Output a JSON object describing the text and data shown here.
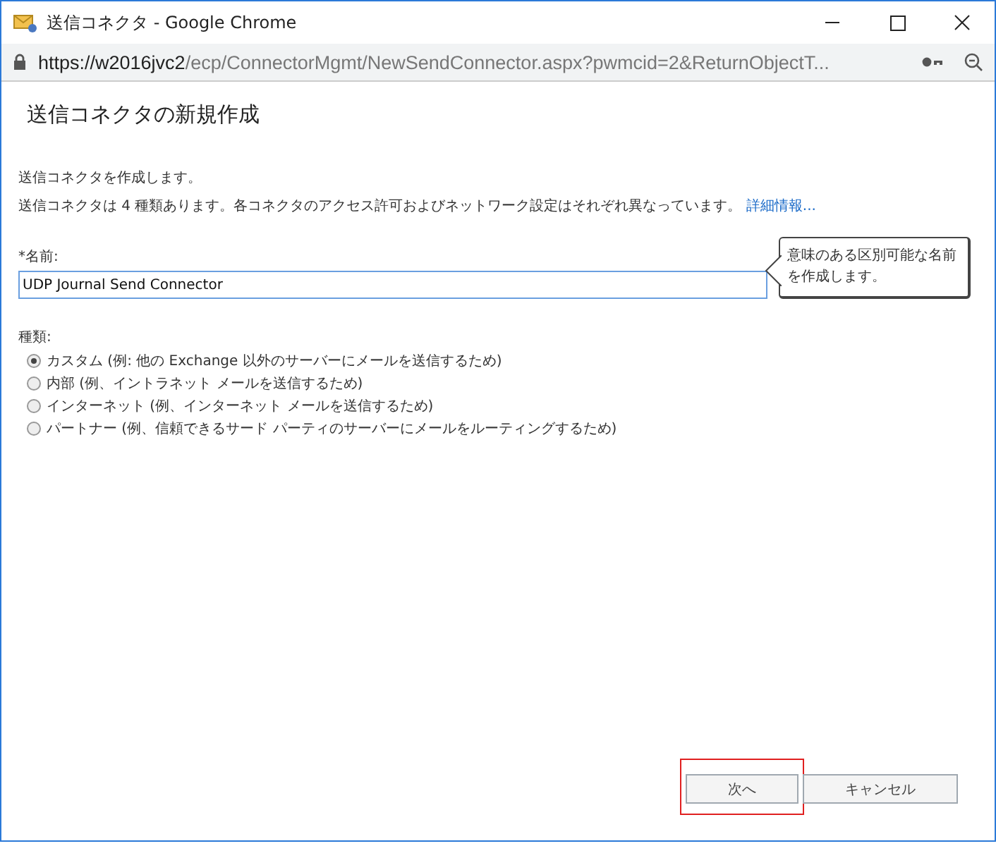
{
  "window": {
    "title": "送信コネクタ - Google Chrome"
  },
  "address_bar": {
    "host": "https://w2016jvc2",
    "path": "/ecp/ConnectorMgmt/NewSendConnector.aspx?pwmcid=2&ReturnObjectT..."
  },
  "heading": "送信コネクタの新規作成",
  "intro": "送信コネクタを作成します。",
  "description": "送信コネクタは 4 種類あります。各コネクタのアクセス許可およびネットワーク設定はそれぞれ異なっています。",
  "learn_more_link": "詳細情報...",
  "name_field": {
    "label": "*名前:",
    "value": "UDP Journal Send Connector",
    "tooltip": "意味のある区別可能な名前を作成します。"
  },
  "type_group": {
    "label": "種類:",
    "options": [
      {
        "label": "カスタム (例: 他の Exchange 以外のサーバーにメールを送信するため)",
        "selected": true
      },
      {
        "label": "内部 (例、イントラネット メールを送信するため)",
        "selected": false
      },
      {
        "label": "インターネット (例、インターネット メールを送信するため)",
        "selected": false
      },
      {
        "label": "パートナー (例、信頼できるサード パーティのサーバーにメールをルーティングするため)",
        "selected": false
      }
    ]
  },
  "buttons": [
    {
      "label": "次へ",
      "highlighted": true
    },
    {
      "label": "キャンセル",
      "highlighted": false
    }
  ]
}
